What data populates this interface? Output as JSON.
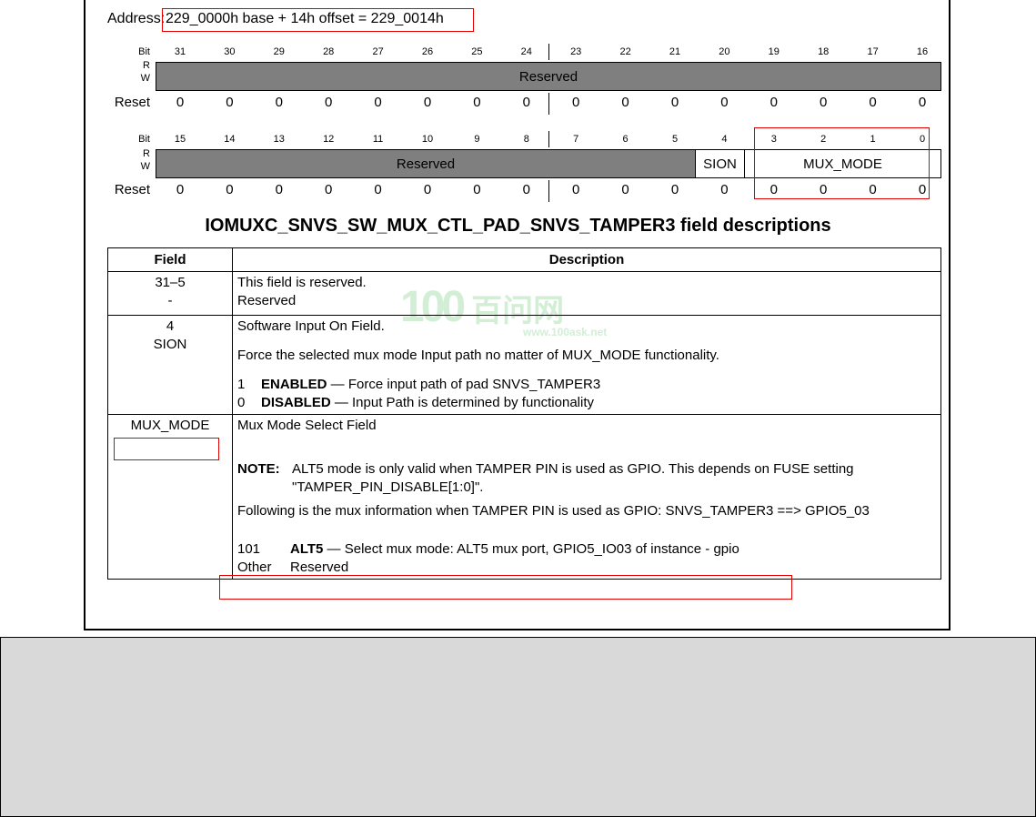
{
  "address": {
    "label": "Address:",
    "value": "229_0000h base + 14h offset = 229_0014h"
  },
  "labels": {
    "bit": "Bit",
    "r": "R",
    "w": "W",
    "reset": "Reset"
  },
  "upper": {
    "bits": [
      "31",
      "30",
      "29",
      "28",
      "27",
      "26",
      "25",
      "24",
      "23",
      "22",
      "21",
      "20",
      "19",
      "18",
      "17",
      "16"
    ],
    "field": "Reserved",
    "reset": [
      "0",
      "0",
      "0",
      "0",
      "0",
      "0",
      "0",
      "0",
      "0",
      "0",
      "0",
      "0",
      "0",
      "0",
      "0",
      "0"
    ]
  },
  "lower": {
    "bits": [
      "15",
      "14",
      "13",
      "12",
      "11",
      "10",
      "9",
      "8",
      "7",
      "6",
      "5",
      "4",
      "3",
      "2",
      "1",
      "0"
    ],
    "reserved": "Reserved",
    "sion": "SION",
    "mux_mode": "MUX_MODE",
    "reset": [
      "0",
      "0",
      "0",
      "0",
      "0",
      "0",
      "0",
      "0",
      "0",
      "0",
      "0",
      "0",
      "0",
      "0",
      "0",
      "0"
    ]
  },
  "table_title": "IOMUXC_SNVS_SW_MUX_CTL_PAD_SNVS_TAMPER3 field descriptions",
  "table": {
    "header_field": "Field",
    "header_desc": "Description",
    "row1": {
      "field": "31–5",
      "field2": "-",
      "line1": "This field is reserved.",
      "line2": "Reserved"
    },
    "row2": {
      "field": "4",
      "field2": "SION",
      "line1": "Software Input On Field.",
      "line2": "Force the selected mux mode Input path no matter of MUX_MODE functionality.",
      "opt1_val": "1",
      "opt1_name": "ENABLED",
      "opt1_desc": " — Force input path of pad SNVS_TAMPER3",
      "opt0_val": "0",
      "opt0_name": "DISABLED",
      "opt0_desc": " — Input Path is determined by functionality"
    },
    "row3": {
      "field": "MUX_MODE",
      "line1": "Mux Mode Select Field",
      "note_label": "NOTE:",
      "note_text": "ALT5 mode is only valid when TAMPER PIN is used as GPIO. This depends on FUSE setting",
      "note_text2": "\"TAMPER_PIN_DISABLE[1:0]\".",
      "line3": "Following is the mux information when TAMPER PIN is used as GPIO: SNVS_TAMPER3 ==> GPIO5_03",
      "alt_val": "101",
      "alt_name": "ALT5",
      "alt_desc": " — Select mux mode: ALT5 mux port, GPIO5_IO03 of instance - gpio",
      "other_val": "Other",
      "other_desc": "Reserved"
    }
  },
  "watermark": {
    "logo": "100",
    "cn": "百问网",
    "url": "www.100ask.net"
  },
  "colors": {
    "highlight": "#e00000",
    "reserved_fill": "#7f7f7f",
    "bottom_panel": "#d9d9d9"
  }
}
